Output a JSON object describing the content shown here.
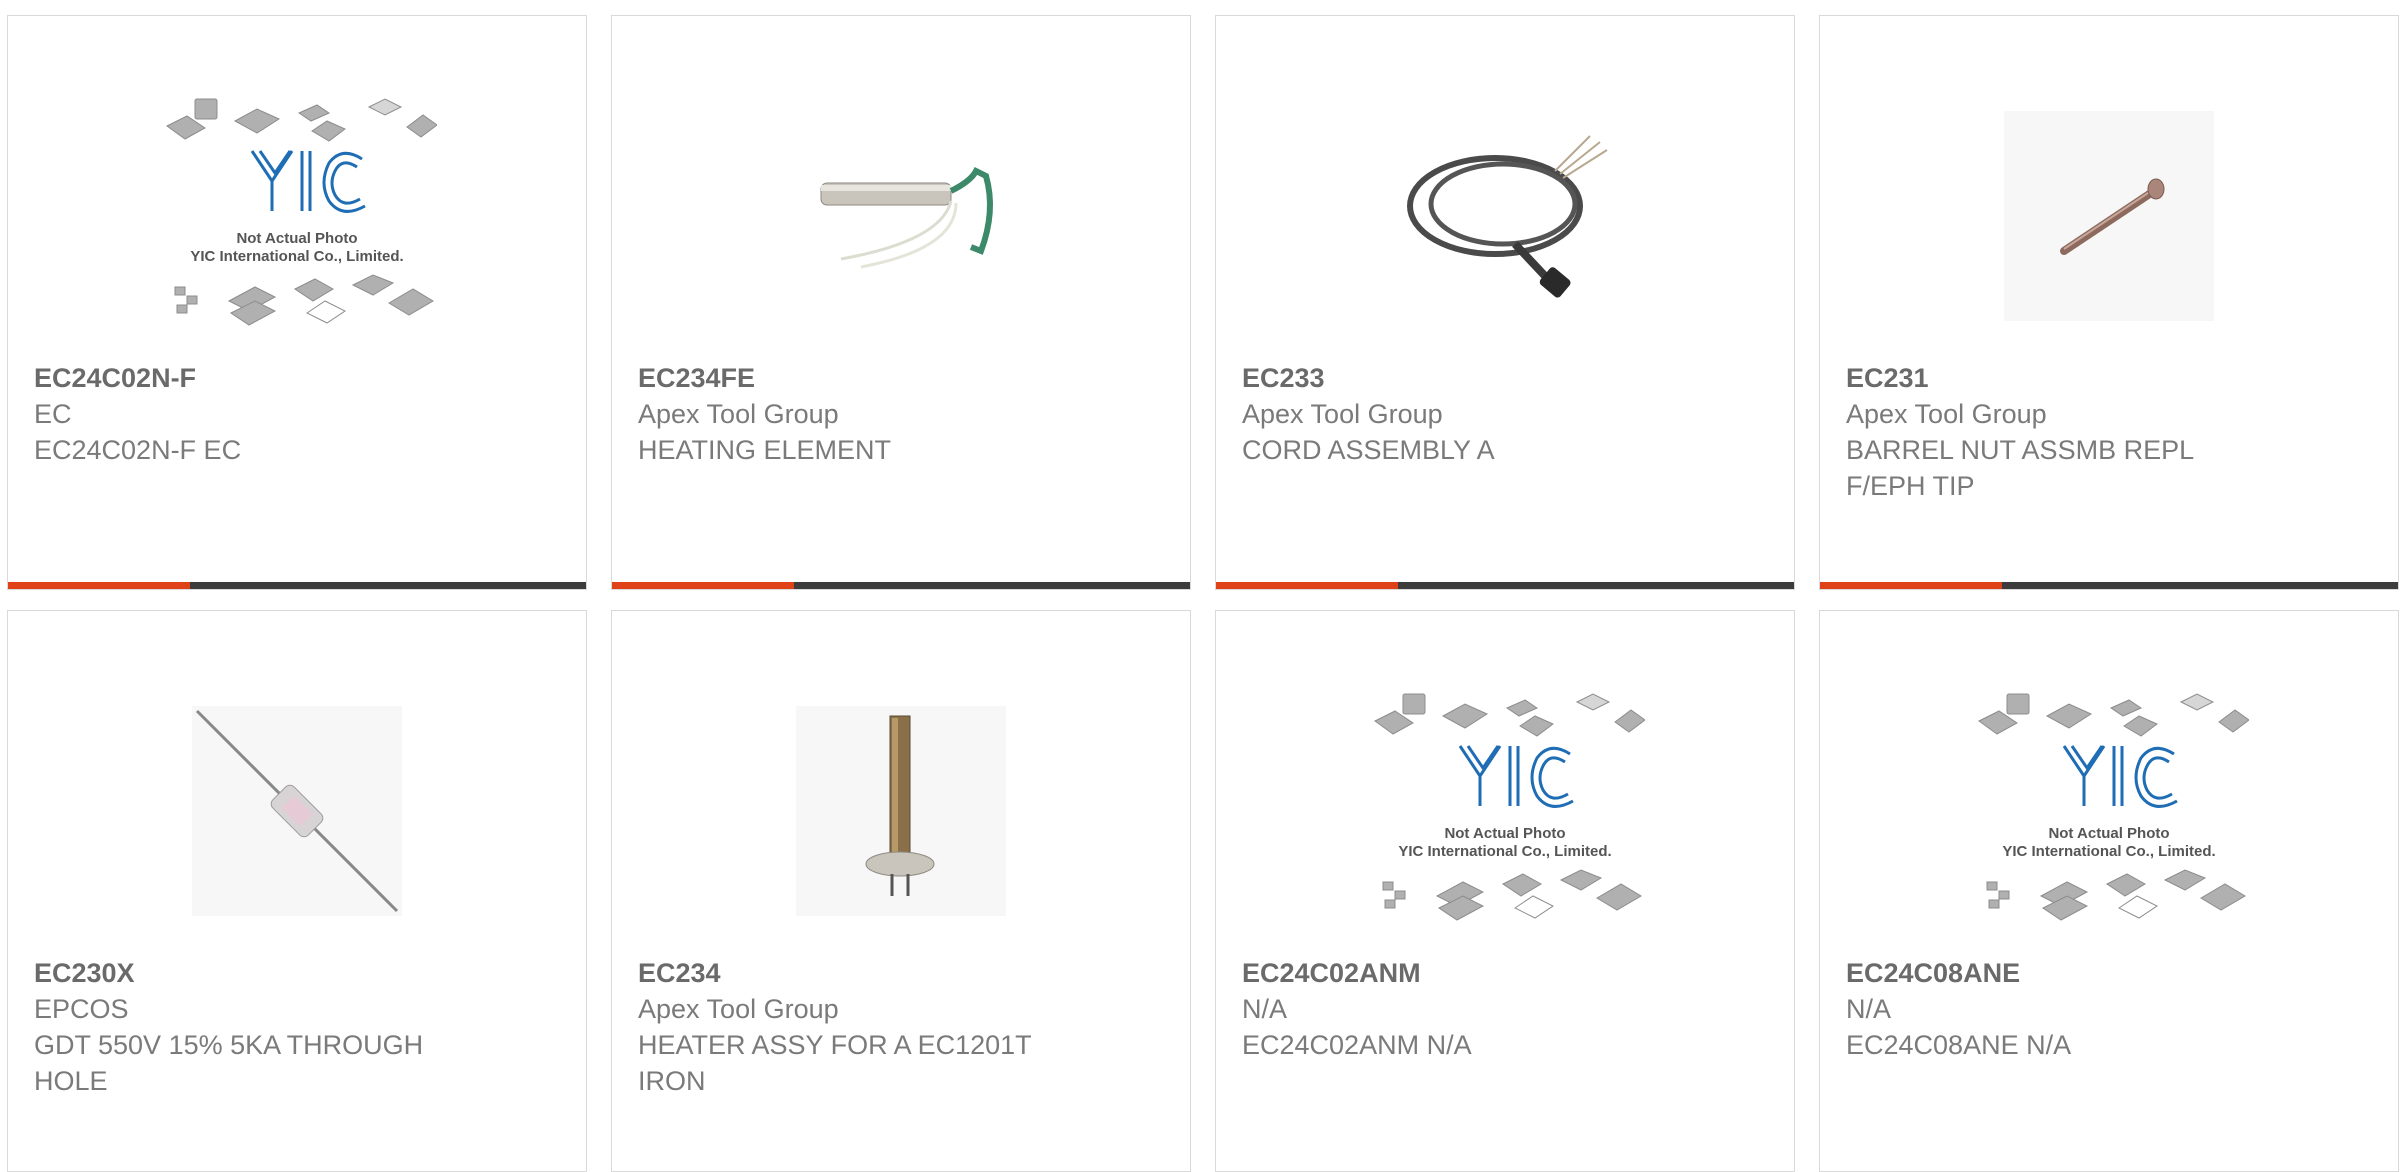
{
  "colors": {
    "accent": "#e04218",
    "bar": "#3c3c3c",
    "border": "#d9d9d9",
    "text_bold": "#6a6a6a",
    "text": "#7a7a7a",
    "logo_blue": "#1e6db5"
  },
  "placeholder": {
    "line1": "Not Actual Photo",
    "line2": "YIC International Co., Limited."
  },
  "products": [
    {
      "part": "EC24C02N-F",
      "manufacturer": "EC",
      "description": "EC24C02N-F EC",
      "image": "placeholder-logo-icon"
    },
    {
      "part": "EC234FE",
      "manufacturer": "Apex Tool Group",
      "description": "HEATING ELEMENT",
      "image": "heating-element-icon"
    },
    {
      "part": "EC233",
      "manufacturer": "Apex Tool Group",
      "description": "CORD ASSEMBLY A",
      "image": "cord-assembly-icon"
    },
    {
      "part": "EC231",
      "manufacturer": "Apex Tool Group",
      "description": "BARREL NUT ASSMB REPL F/EPH TIP",
      "image": "barrel-nut-icon"
    },
    {
      "part": "EC230X",
      "manufacturer": "EPCOS",
      "description": "GDT 550V 15% 5KA THROUGH HOLE",
      "image": "gdt-icon"
    },
    {
      "part": "EC234",
      "manufacturer": "Apex Tool Group",
      "description": "HEATER ASSY FOR A EC1201T IRON",
      "image": "heater-assy-icon"
    },
    {
      "part": "EC24C02ANM",
      "manufacturer": "N/A",
      "description": "EC24C02ANM N/A",
      "image": "placeholder-logo-icon"
    },
    {
      "part": "EC24C08ANE",
      "manufacturer": "N/A",
      "description": "EC24C08ANE N/A",
      "image": "placeholder-logo-icon"
    }
  ]
}
